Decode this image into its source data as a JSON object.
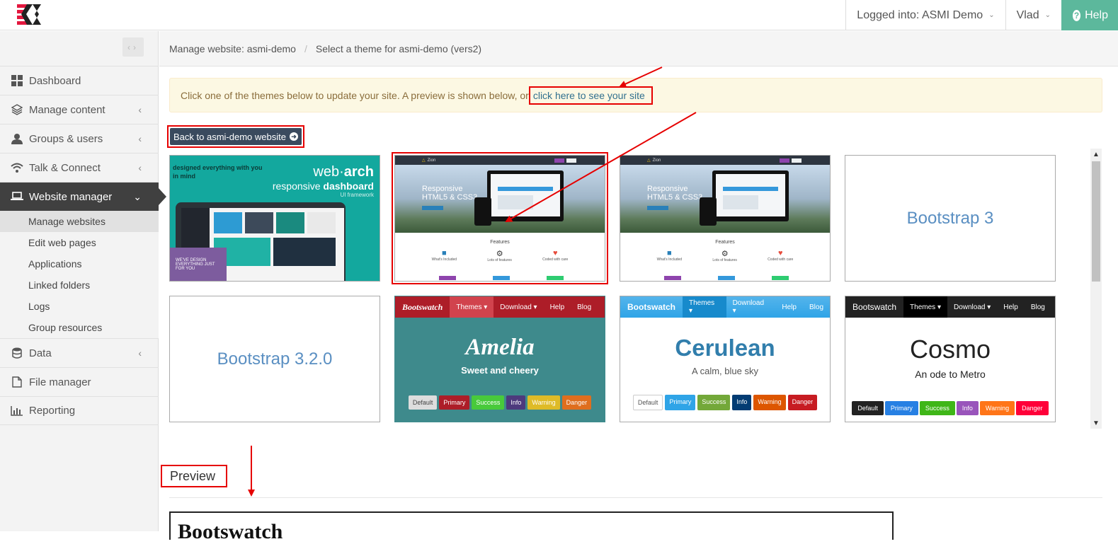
{
  "topbar": {
    "logged_into": "Logged into: ASMI Demo",
    "user": "Vlad",
    "help": "Help"
  },
  "sidebar": {
    "items": [
      {
        "label": "Dashboard",
        "icon": "dashboard-icon"
      },
      {
        "label": "Manage content",
        "icon": "layers-icon"
      },
      {
        "label": "Groups & users",
        "icon": "user-icon"
      },
      {
        "label": "Talk & Connect",
        "icon": "wifi-icon"
      },
      {
        "label": "Website manager",
        "icon": "laptop-icon"
      },
      {
        "label": "Data",
        "icon": "database-icon"
      },
      {
        "label": "File manager",
        "icon": "file-icon"
      },
      {
        "label": "Reporting",
        "icon": "bar-chart-icon"
      }
    ],
    "subitems": [
      "Manage websites",
      "Edit web pages",
      "Applications",
      "Linked folders",
      "Logs",
      "Group resources"
    ]
  },
  "breadcrumb": {
    "first": "Manage website: asmi-demo",
    "second": "Select a theme for asmi-demo (vers2)"
  },
  "alert": {
    "text": "Click one of the themes below to update your site. A preview is shown below, or",
    "link": "click here to see your site"
  },
  "back_button": "Back to asmi-demo website",
  "themes": {
    "webarch": {
      "line1": "designed everything with you",
      "line2": "in mind",
      "brand_a": "web",
      "brand_b": "arch",
      "tag1": "responsive",
      "tag2": "dashboard",
      "tag3": "UI framework",
      "promo1": "WE'VE DESIGN",
      "promo2": "EVERYTHING JUST FOR YOU"
    },
    "zion": {
      "brand": "Zion",
      "headline1": "Responsive",
      "headline2": "HTML5 & CSS3",
      "features": "Features",
      "f1": "What's Included",
      "f2": "Lots of features",
      "f3": "Coded with care"
    },
    "bootstrap3": "Bootstrap 3",
    "bootstrap320": "Bootstrap 3.2.0",
    "amelia": {
      "brand": "Bootswatch",
      "nav": [
        "Themes ▾",
        "Download ▾",
        "Help",
        "Blog"
      ],
      "title": "Amelia",
      "subtitle": "Sweet and cheery",
      "buttons": [
        "Default",
        "Primary",
        "Success",
        "Info",
        "Warning",
        "Danger"
      ]
    },
    "cerulean": {
      "brand": "Bootswatch",
      "nav": [
        "Themes ▾",
        "Download ▾",
        "Help",
        "Blog"
      ],
      "title": "Cerulean",
      "subtitle": "A calm, blue sky",
      "buttons": [
        "Default",
        "Primary",
        "Success",
        "Info",
        "Warning",
        "Danger"
      ]
    },
    "cosmo": {
      "brand": "Bootswatch",
      "nav": [
        "Themes ▾",
        "Download ▾",
        "Help",
        "Blog"
      ],
      "title": "Cosmo",
      "subtitle": "An ode to Metro",
      "buttons": [
        "Default",
        "Primary",
        "Success",
        "Info",
        "Warning",
        "Danger"
      ]
    }
  },
  "preview": {
    "title": "Preview",
    "frame_heading": "Bootswatch"
  },
  "colors": {
    "help_bg": "#5cb89c",
    "active_nav": "#404040",
    "annotation": "#e60000"
  }
}
